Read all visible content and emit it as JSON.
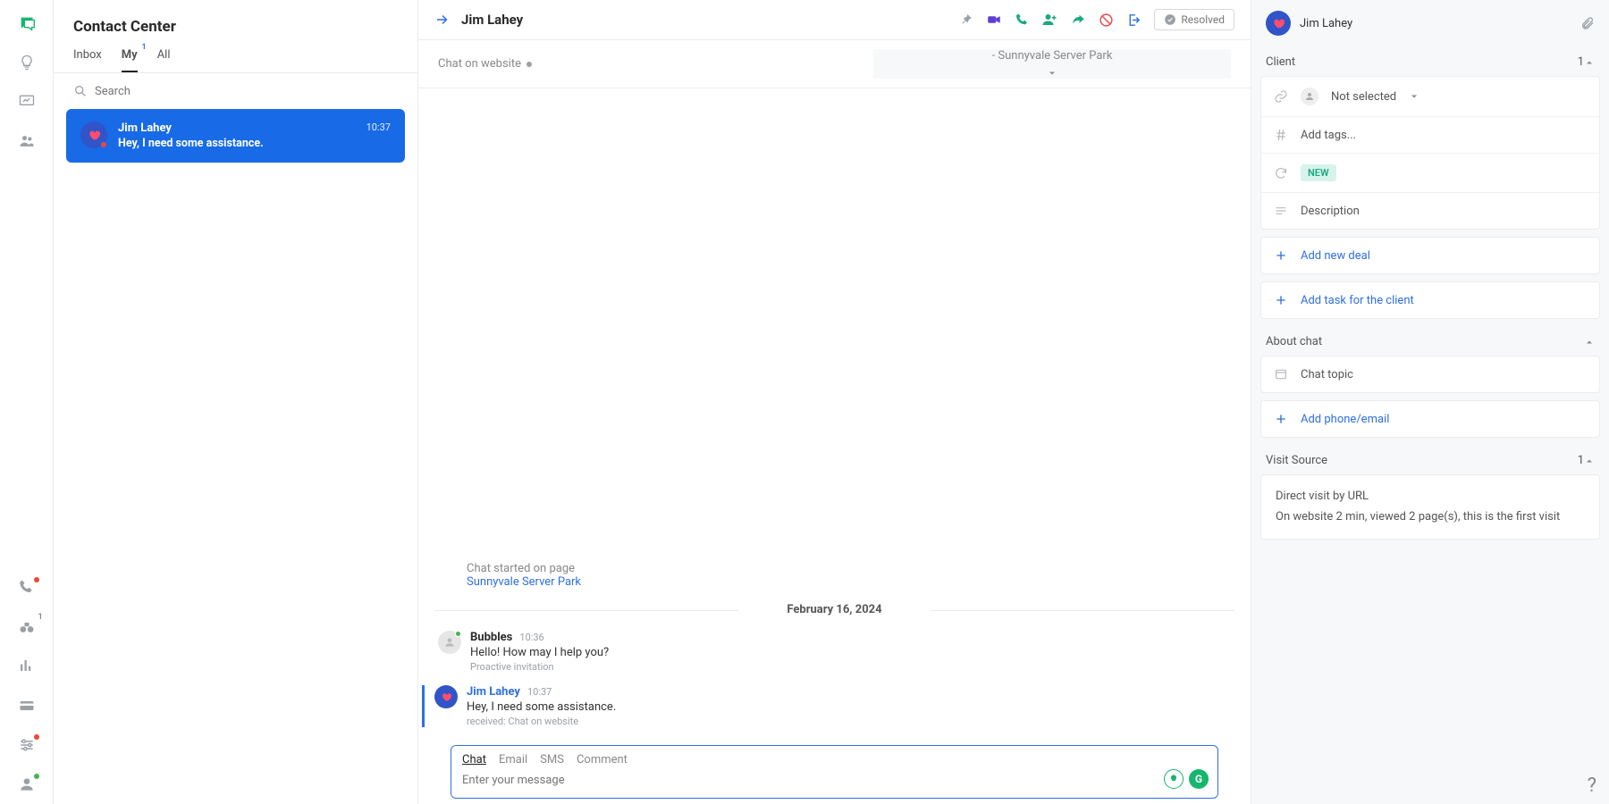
{
  "sidebar": {
    "title": "Contact Center",
    "tabs": {
      "inbox": "Inbox",
      "my": "My",
      "my_count": "1",
      "all": "All"
    },
    "search_placeholder": "Search",
    "conversation": {
      "name": "Jim Lahey",
      "preview": "Hey, I need some assistance.",
      "time": "10:37"
    }
  },
  "chat": {
    "header_name": "Jim Lahey",
    "resolved_label": "Resolved",
    "channel_label": "Chat on website",
    "location_label": "- Sunnyvale Server Park",
    "started_label": "Chat started on page",
    "started_link": "Sunnyvale Server Park",
    "date": "February 16, 2024",
    "messages": [
      {
        "author": "Bubbles",
        "time": "10:36",
        "text": "Hello! How may I help you?",
        "meta": "Proactive invitation",
        "client": false
      },
      {
        "author": "Jim Lahey",
        "time": "10:37",
        "text": "Hey, I need some assistance.",
        "meta": "received: Chat on website",
        "client": true
      }
    ],
    "composer": {
      "tabs": {
        "chat": "Chat",
        "email": "Email",
        "sms": "SMS",
        "comment": "Comment"
      },
      "placeholder": "Enter your message"
    }
  },
  "right": {
    "name": "Jim Lahey",
    "client_section": "Client",
    "client_count": "1",
    "not_selected": "Not selected",
    "add_tags": "Add tags...",
    "status_new": "NEW",
    "description": "Description",
    "add_deal": "Add new deal",
    "add_task": "Add task for the client",
    "about_chat": "About chat",
    "chat_topic": "Chat topic",
    "add_phone": "Add phone/email",
    "visit_source": "Visit Source",
    "visit_count": "1",
    "visit_line1": "Direct visit by URL",
    "visit_line2": "On website 2 min, viewed 2 page(s), this is the first visit"
  },
  "rail": {
    "badge": "1"
  }
}
